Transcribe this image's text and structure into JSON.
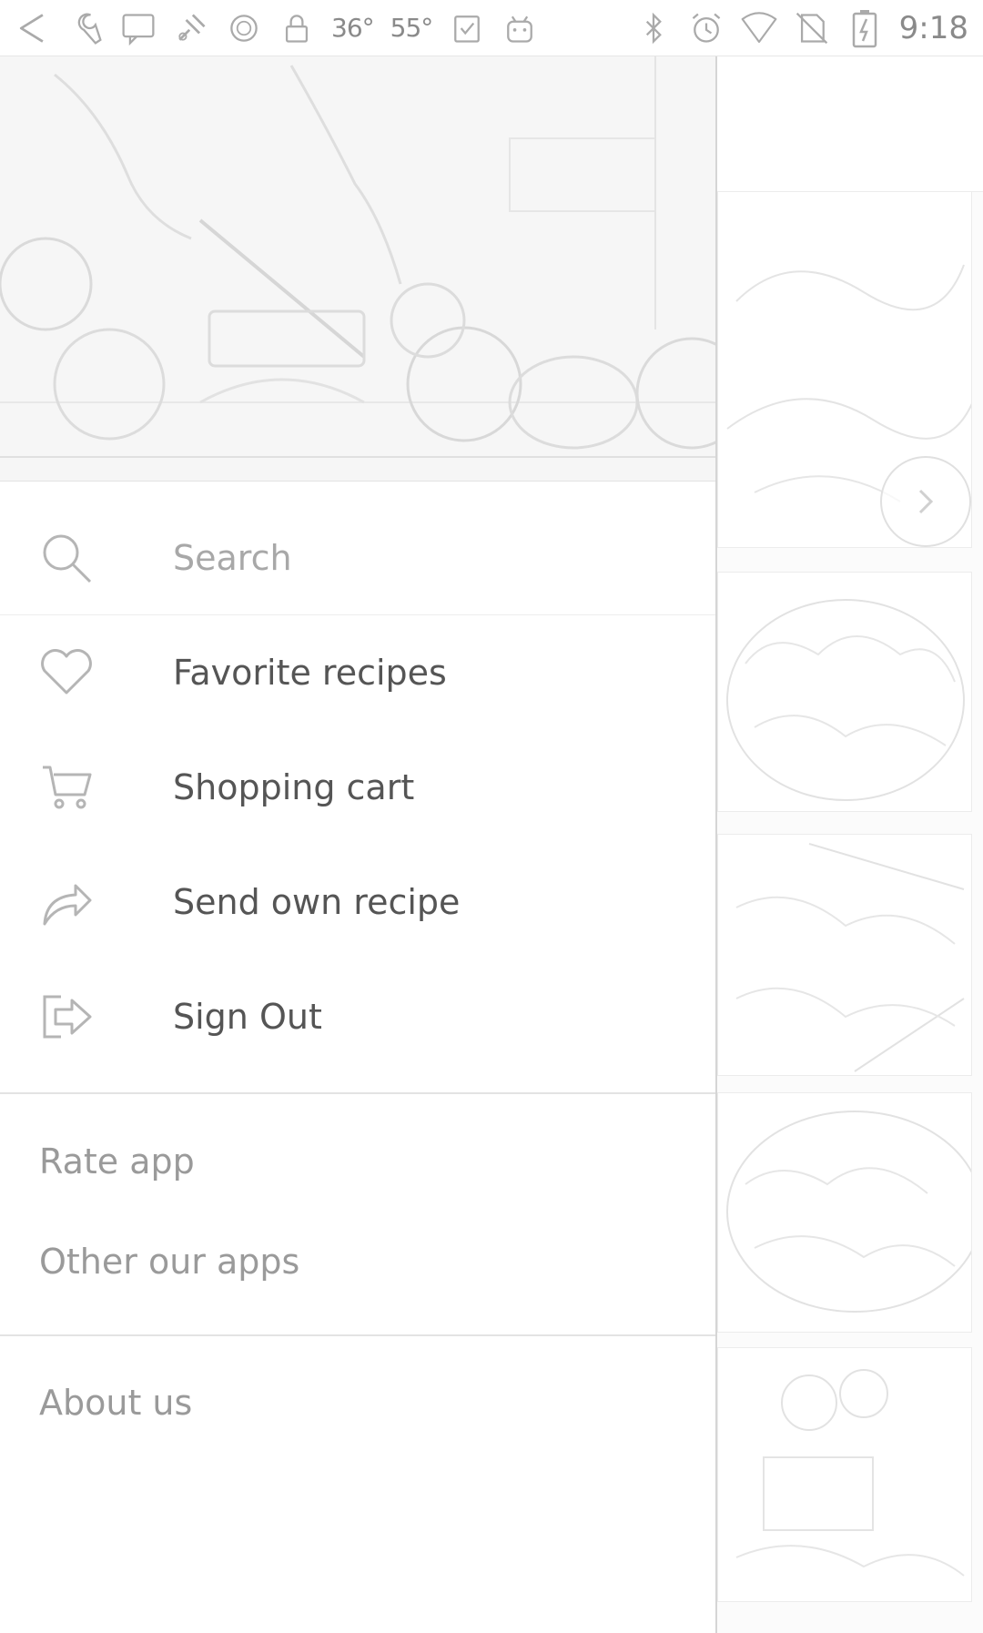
{
  "status_bar": {
    "left_icons": [
      "back-arrow-icon",
      "wrench-icon",
      "message-icon",
      "satellite-icon",
      "circle-icon",
      "lock-icon"
    ],
    "temp_1": "36°",
    "temp_2": "55°",
    "right_icons": [
      "clipboard-check-icon",
      "android-icon",
      "bluetooth-icon",
      "alarm-icon",
      "wifi-icon",
      "no-sim-icon",
      "battery-charging-icon"
    ],
    "time": "9:18"
  },
  "drawer": {
    "header_image": "kitchen-vegetables-image",
    "items": [
      {
        "label": "Search",
        "icon": "search-icon"
      },
      {
        "label": "Favorite recipes",
        "icon": "heart-icon"
      },
      {
        "label": "Shopping cart",
        "icon": "cart-icon"
      },
      {
        "label": "Send own recipe",
        "icon": "share-arrow-icon"
      },
      {
        "label": "Sign Out",
        "icon": "sign-out-icon"
      }
    ],
    "secondary": [
      {
        "label": "Rate app"
      },
      {
        "label": "Other our apps"
      }
    ],
    "footer": [
      {
        "label": "About us"
      }
    ]
  },
  "background": {
    "cards": [
      "food-photo-1",
      "food-photo-2",
      "food-photo-3",
      "food-photo-4",
      "food-photo-5"
    ]
  },
  "colors": {
    "line": "#cfcfcf",
    "text": "#555555",
    "muted_text": "#a8a8a8"
  }
}
